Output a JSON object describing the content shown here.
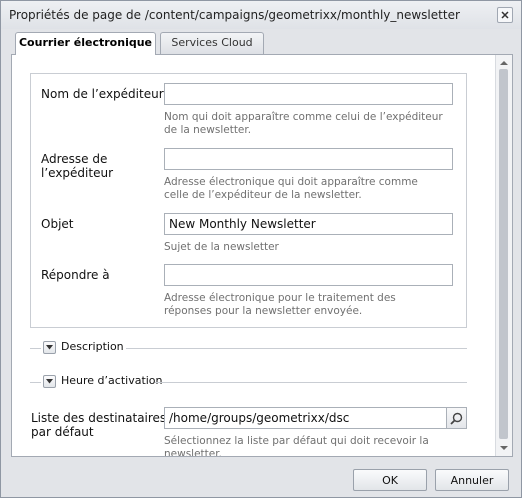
{
  "dialog": {
    "title": "Propriétés de page de /content/campaigns/geometrixx/monthly_newsletter"
  },
  "tabs": [
    {
      "label": "Courrier électronique",
      "active": true
    },
    {
      "label": "Services Cloud",
      "active": false
    }
  ],
  "form": {
    "sender_name": {
      "label": "Nom de l’expéditeur",
      "value": "",
      "help": "Nom qui doit apparaître comme celui de l’expéditeur de la newsletter."
    },
    "sender_address": {
      "label_line1": "Adresse de",
      "label_line2": "l’expéditeur",
      "value": "",
      "help": "Adresse électronique qui doit apparaître comme celle de l’expéditeur de la newsletter."
    },
    "subject": {
      "label": "Objet",
      "value": "New Monthly Newsletter",
      "help": "Sujet de la newsletter"
    },
    "reply_to": {
      "label": "Répondre à",
      "value": "",
      "help": "Adresse électronique pour le traitement des réponses pour la newsletter envoyée."
    }
  },
  "sections": {
    "description": "Description",
    "activation_time": "Heure d’activation"
  },
  "recipients": {
    "label_line1": "Liste des destinataires",
    "label_line2": "par défaut",
    "value": "/home/groups/geometrixx/dsc",
    "help": "Sélectionnez la liste par défaut qui doit recevoir la newsletter."
  },
  "footer": {
    "ok_label": "OK",
    "cancel_label": "Annuler"
  },
  "colors": {
    "dialog_bg": "#e2e4e8",
    "panel_bg": "#ffffff",
    "help_text": "#707070"
  }
}
